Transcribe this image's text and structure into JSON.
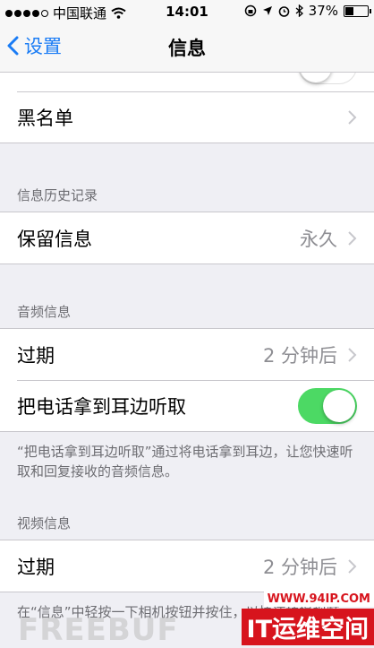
{
  "status_bar": {
    "carrier": "中国联通",
    "time": "14:01",
    "battery": "37%",
    "battery_level": 0.37,
    "icons": [
      "signal-dots-icon",
      "wifi-icon",
      "rotation-lock-icon",
      "location-icon",
      "alarm-icon",
      "bluetooth-icon",
      "battery-icon"
    ]
  },
  "nav": {
    "back_label": "设置",
    "title": "信息"
  },
  "sections": {
    "top": {
      "partial_row": {
        "toggle_on": false
      },
      "blocked_label": "黑名单"
    },
    "history": {
      "header": "信息历史记录",
      "keep_label": "保留信息",
      "keep_value": "永久"
    },
    "audio": {
      "header": "音频信息",
      "expire_label": "过期",
      "expire_value": "2 分钟后",
      "raise_label": "把电话拿到耳边听取",
      "raise_toggle_on": true,
      "footer": "“把电话拿到耳边听取”通过将电话拿到耳边，让您快速听取和回复接收的音频信息。"
    },
    "video": {
      "header": "视频信息",
      "expire_label": "过期",
      "expire_value": "2 分钟后",
      "footer": "在“信息”中轻按一下相机按钮并按住，以快速拍摄视频。"
    }
  },
  "watermarks": {
    "left": "FREEBUF",
    "right_url": "WWW.94IP.COM",
    "right_brand": "IT运维空间"
  },
  "colors": {
    "accent": "#1a7cf5",
    "toggle_on": "#4cd964",
    "background": "#efeff4",
    "brand_red": "#d7141d"
  }
}
